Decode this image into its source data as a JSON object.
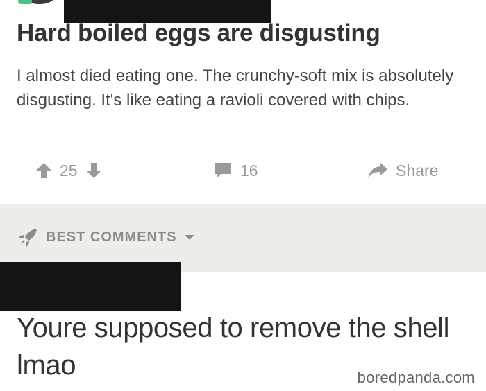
{
  "post": {
    "title": "Hard boiled eggs are disgusting",
    "body": "I almost died eating one. The crunchy-soft mix is absolutely disgusting. It's like eating a ravioli covered with chips.",
    "upvotes": "25",
    "comment_count": "16",
    "share_label": "Share",
    "accent_color": "#4fc08d"
  },
  "comments_section": {
    "header": "BEST COMMENTS",
    "top_comment": "Youre supposed to remove the shell lmao"
  },
  "watermark": "boredpanda.com",
  "icons": {
    "upvote": "arrow-up-icon",
    "downvote": "arrow-down-icon",
    "comment": "speech-bubble-icon",
    "share": "share-arrow-icon",
    "best": "rocket-icon",
    "dropdown": "caret-down-icon"
  }
}
